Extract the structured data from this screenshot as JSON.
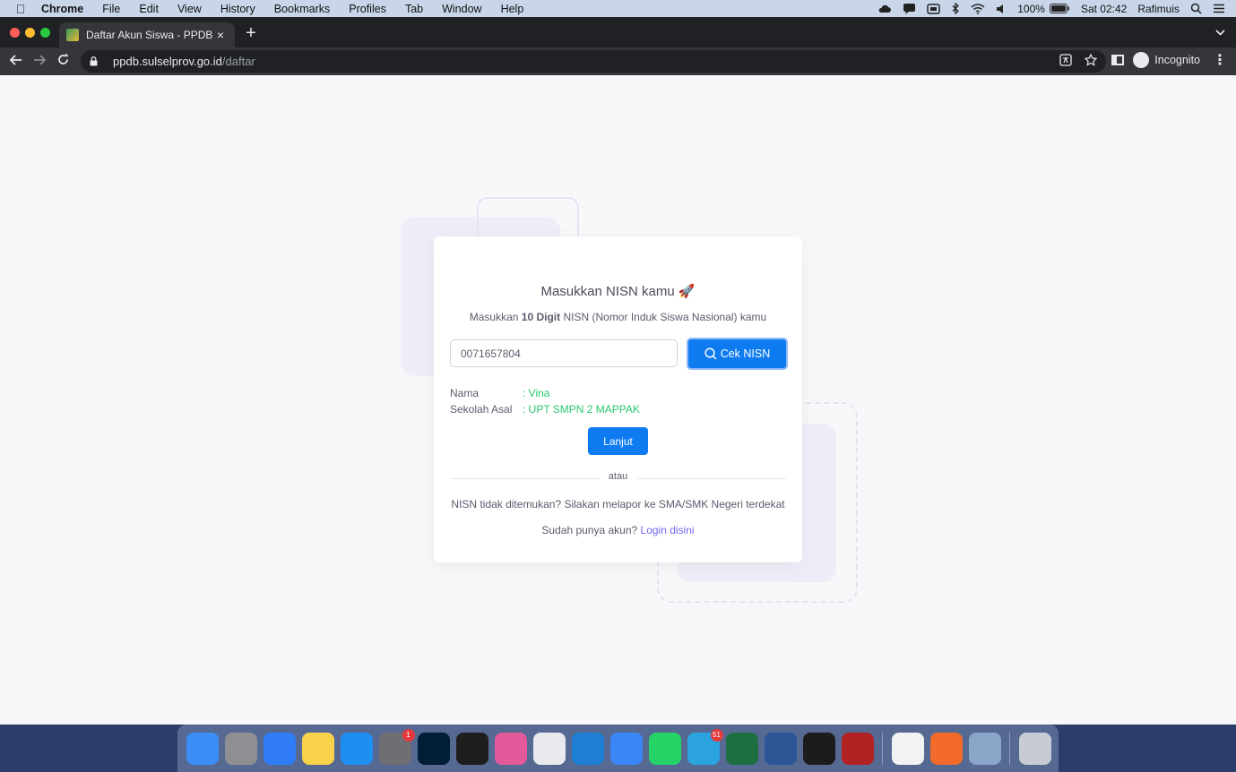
{
  "menubar": {
    "app_name": "Chrome",
    "items": [
      "File",
      "Edit",
      "View",
      "History",
      "Bookmarks",
      "Profiles",
      "Tab",
      "Window",
      "Help"
    ],
    "battery": "100%",
    "clock": "Sat 02:42",
    "user": "Rafimuis"
  },
  "browser": {
    "tab_title": "Daftar Akun Siswa - PPDB Sulawesi",
    "url_host": "ppdb.sulselprov.go.id",
    "url_path": "/daftar",
    "profile_label": "Incognito"
  },
  "page": {
    "heading": "Masukkan NISN kamu 🚀",
    "subtitle_prefix": "Masukkan ",
    "subtitle_bold": "10 Digit",
    "subtitle_suffix": " NISN (Nomor Induk Siswa Nasional) kamu",
    "nisn_value": "0071657804",
    "check_button": "Cek NISN",
    "result": {
      "name_label": "Nama",
      "name_value": ": Vina",
      "school_label": "Sekolah Asal",
      "school_value": ": UPT SMPN 2 MAPPAK"
    },
    "continue_button": "Lanjut",
    "divider_text": "atau",
    "not_found_text": "NISN tidak ditemukan? Silakan melapor ke SMA/SMK Negeri terdekat",
    "login_prompt": "Sudah punya akun? ",
    "login_link": "Login disini"
  },
  "dock": {
    "apps": [
      {
        "name": "finder-icon",
        "color": "#3a8ef6"
      },
      {
        "name": "launchpad-icon",
        "color": "#8e8e93"
      },
      {
        "name": "safari-icon",
        "color": "#2f7cf6"
      },
      {
        "name": "notes-icon",
        "color": "#f7d24a"
      },
      {
        "name": "app-store-icon",
        "color": "#1f8ef1"
      },
      {
        "name": "system-preferences-icon",
        "color": "#6e6e73",
        "badge": "1"
      },
      {
        "name": "photoshop-icon",
        "color": "#001e36"
      },
      {
        "name": "figma-icon",
        "color": "#1e1e1e"
      },
      {
        "name": "ckey-icon",
        "color": "#e25a9a"
      },
      {
        "name": "chrome-icon",
        "color": "#e8eaed"
      },
      {
        "name": "vscode-icon",
        "color": "#1f7fd6"
      },
      {
        "name": "mindnode-icon",
        "color": "#3b86f7"
      },
      {
        "name": "whatsapp-icon",
        "color": "#25d366"
      },
      {
        "name": "telegram-icon",
        "color": "#2aa3df",
        "badge": "51"
      },
      {
        "name": "excel-icon",
        "color": "#1d6f42"
      },
      {
        "name": "word-icon",
        "color": "#2b5797"
      },
      {
        "name": "terminal-icon",
        "color": "#1c1c1e"
      },
      {
        "name": "filezilla-icon",
        "color": "#b22222"
      },
      {
        "name": "textedit-icon",
        "color": "#f2f2f2"
      },
      {
        "name": "vectornator-icon",
        "color": "#f26b2a"
      },
      {
        "name": "preview-icon",
        "color": "#8aa5c8"
      },
      {
        "name": "trash-icon",
        "color": "#c7ccd4"
      }
    ]
  }
}
